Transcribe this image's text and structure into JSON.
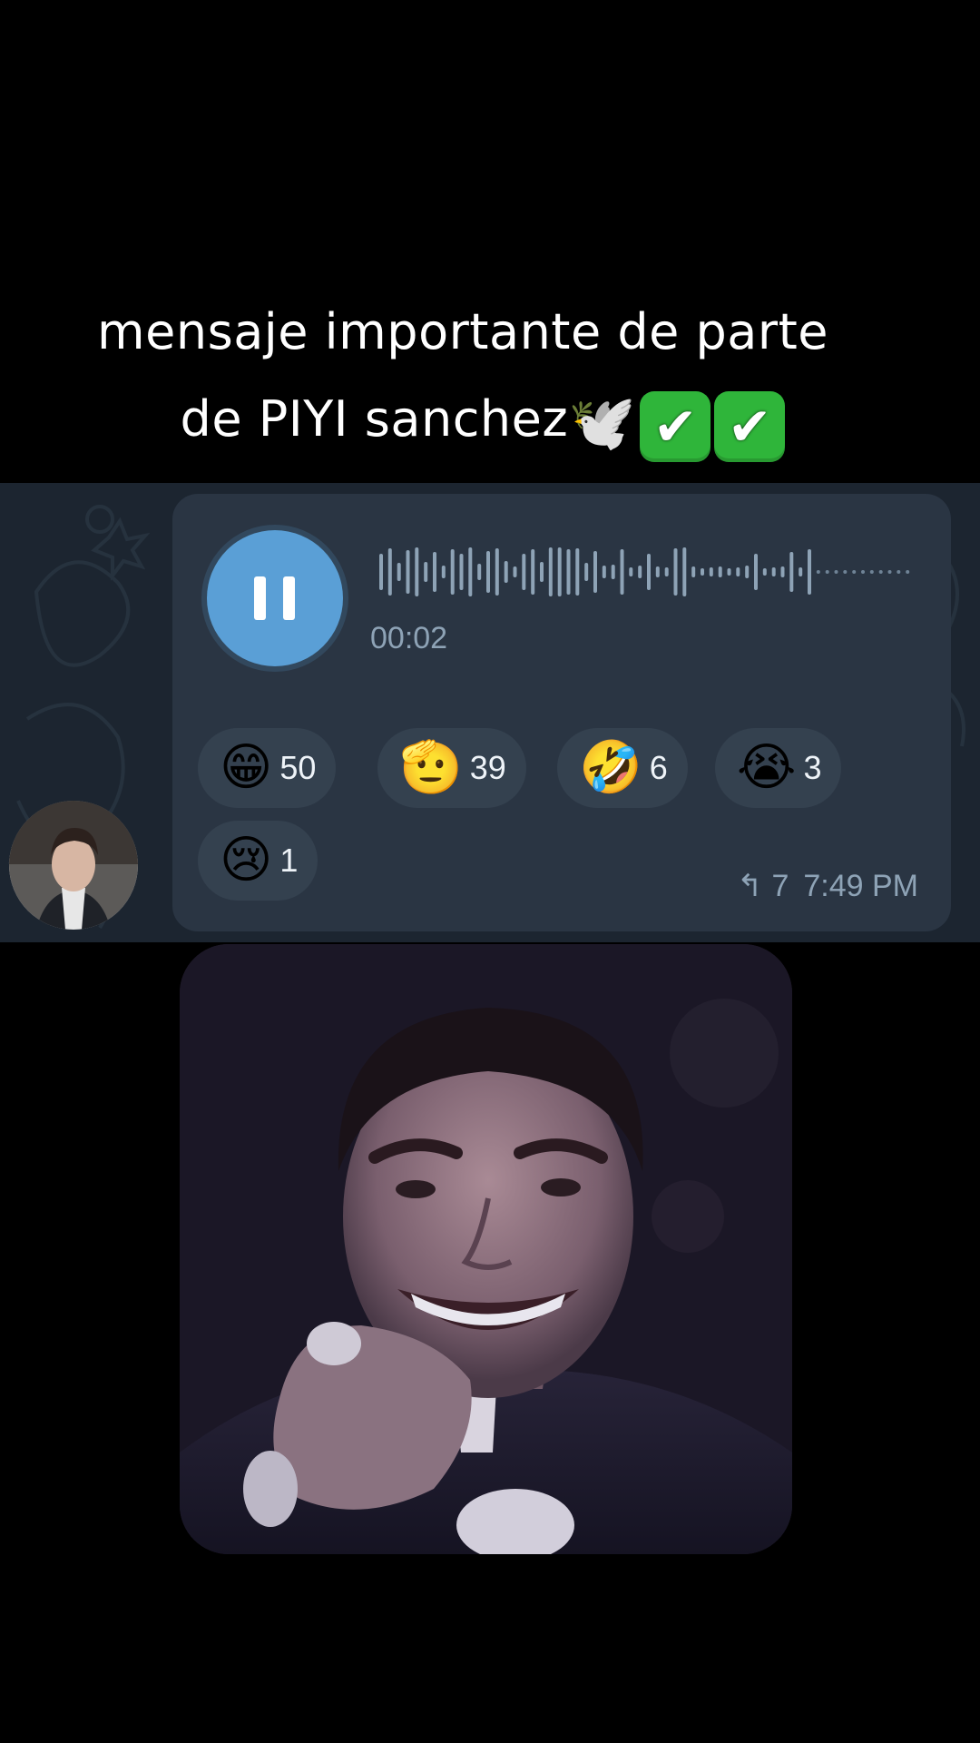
{
  "caption": {
    "line1": "mensaje importante de parte",
    "line2_text": "de PIYI sanchez",
    "line2_emoji": "🕊️",
    "checkmarks": [
      "✔",
      "✔"
    ]
  },
  "voice_message": {
    "state": "playing",
    "duration": "00:02",
    "played_fraction": 0.16
  },
  "reactions": [
    {
      "emoji": "😁",
      "count": "50"
    },
    {
      "emoji": "🫡",
      "count": "39"
    },
    {
      "emoji": "🤣",
      "count": "6"
    },
    {
      "emoji": "😭",
      "count": "3"
    },
    {
      "emoji": "😢",
      "count": "1"
    }
  ],
  "meta": {
    "reply_icon": "↰",
    "forwards": "7",
    "time": "7:49 PM"
  },
  "colors": {
    "bubble": "#2a3543",
    "accent": "#5a9fd6",
    "muted_text": "#8ea3b6"
  }
}
